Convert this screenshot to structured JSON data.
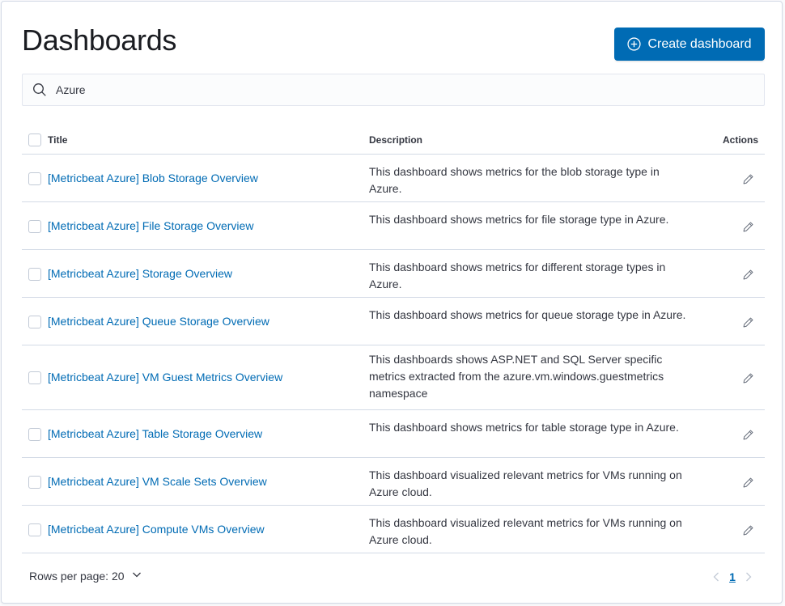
{
  "page": {
    "title": "Dashboards",
    "create_button_label": "Create dashboard"
  },
  "search": {
    "value": "Azure"
  },
  "table": {
    "columns": {
      "title": "Title",
      "description": "Description",
      "actions": "Actions"
    },
    "rows": [
      {
        "title": "[Metricbeat Azure] Blob Storage Overview",
        "description": "This dashboard shows metrics for the blob storage type in Azure."
      },
      {
        "title": "[Metricbeat Azure] File Storage Overview",
        "description": "This dashboard shows metrics for file storage type in Azure."
      },
      {
        "title": "[Metricbeat Azure] Storage Overview",
        "description": "This dashboard shows metrics for different storage types in Azure."
      },
      {
        "title": "[Metricbeat Azure] Queue Storage Overview",
        "description": "This dashboard shows metrics for queue storage type in Azure."
      },
      {
        "title": "[Metricbeat Azure] VM Guest Metrics Overview",
        "description": "This dashboards shows ASP.NET and SQL Server specific metrics extracted from the azure.vm.windows.guestmetrics namespace"
      },
      {
        "title": "[Metricbeat Azure] Table Storage Overview",
        "description": "This dashboard shows metrics for table storage type in Azure."
      },
      {
        "title": "[Metricbeat Azure] VM Scale Sets Overview",
        "description": "This dashboard visualized relevant metrics for VMs running on Azure cloud."
      },
      {
        "title": "[Metricbeat Azure] Compute VMs Overview",
        "description": "This dashboard visualized relevant metrics for VMs running on Azure cloud."
      }
    ]
  },
  "pagination": {
    "rows_per_page_label": "Rows per page: 20",
    "current_page": "1"
  },
  "icons": {
    "create": "plus-in-circle-icon",
    "search": "search-icon",
    "edit": "pencil-icon",
    "rows_per_page": "chevron-down-icon",
    "prev": "chevron-left-icon",
    "next": "chevron-right-icon"
  },
  "colors": {
    "primary": "#006bb4",
    "border": "#d3dae6",
    "text": "#343741"
  }
}
